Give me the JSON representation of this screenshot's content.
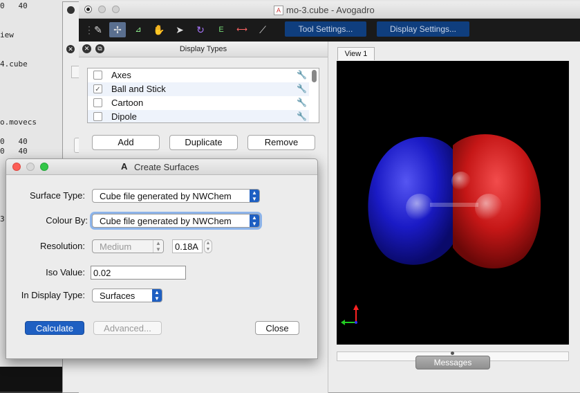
{
  "terminal": {
    "lines": [
      "0   40",
      "iew",
      "4.cube",
      "o.movecs",
      "0   40",
      "0   40",
      "3"
    ]
  },
  "window": {
    "title": "mo-3.cube - Avogadro",
    "toolbar": {
      "tool_settings_label": "Tool Settings...",
      "display_settings_label": "Display Settings..."
    }
  },
  "display_types": {
    "title": "Display Types",
    "items": [
      {
        "label": "Axes",
        "checked": false
      },
      {
        "label": "Ball and Stick",
        "checked": true
      },
      {
        "label": "Cartoon",
        "checked": false
      },
      {
        "label": "Dipole",
        "checked": false
      }
    ],
    "buttons": {
      "add": "Add",
      "duplicate": "Duplicate",
      "remove": "Remove"
    }
  },
  "view": {
    "tab_label": "View 1",
    "messages_label": "Messages"
  },
  "dialog": {
    "title": "Create Surfaces",
    "surface_type": {
      "label": "Surface Type:",
      "value": "Cube file generated by NWChem"
    },
    "colour_by": {
      "label": "Colour By:",
      "value": "Cube file generated by NWChem"
    },
    "resolution": {
      "label": "Resolution:",
      "value": "Medium",
      "step": "0.18A"
    },
    "iso_value": {
      "label": "Iso Value:",
      "value": "0.02"
    },
    "display_type": {
      "label": "In Display Type:",
      "value": "Surfaces"
    },
    "buttons": {
      "calculate": "Calculate",
      "advanced": "Advanced...",
      "close": "Close"
    }
  },
  "colors": {
    "accent": "#1e5fc2",
    "positive_lobe": "#d01818",
    "negative_lobe": "#1c1cd0",
    "toolbar_button": "#0f3e7e"
  }
}
